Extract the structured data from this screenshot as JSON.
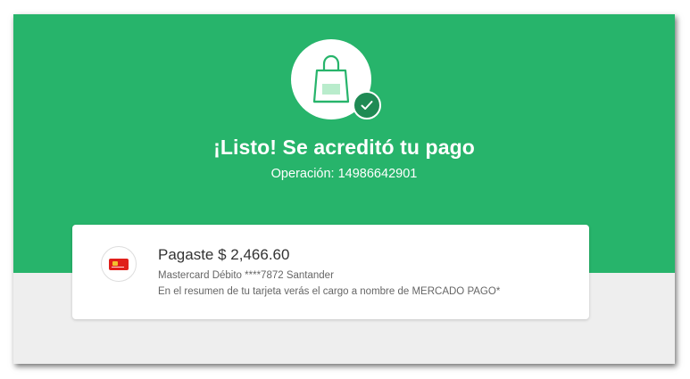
{
  "header": {
    "title": "¡Listo! Se acreditó tu pago",
    "operation": "Operación: 14986642901",
    "icon": "shopping-bag-icon",
    "badge_icon": "check-icon"
  },
  "payment": {
    "paid_text": "Pagaste $ 2,466.60",
    "card_text": "Mastercard Débito ****7872 Santander",
    "statement_note": "En el resumen de tu tarjeta verás el cargo a nombre de MERCADO PAGO*",
    "logo_icon": "santander-card-icon"
  },
  "colors": {
    "hero_green": "#27b46b",
    "badge_green": "#1f8a54",
    "background": "#eeeeee",
    "card_red": "#e0201b"
  }
}
